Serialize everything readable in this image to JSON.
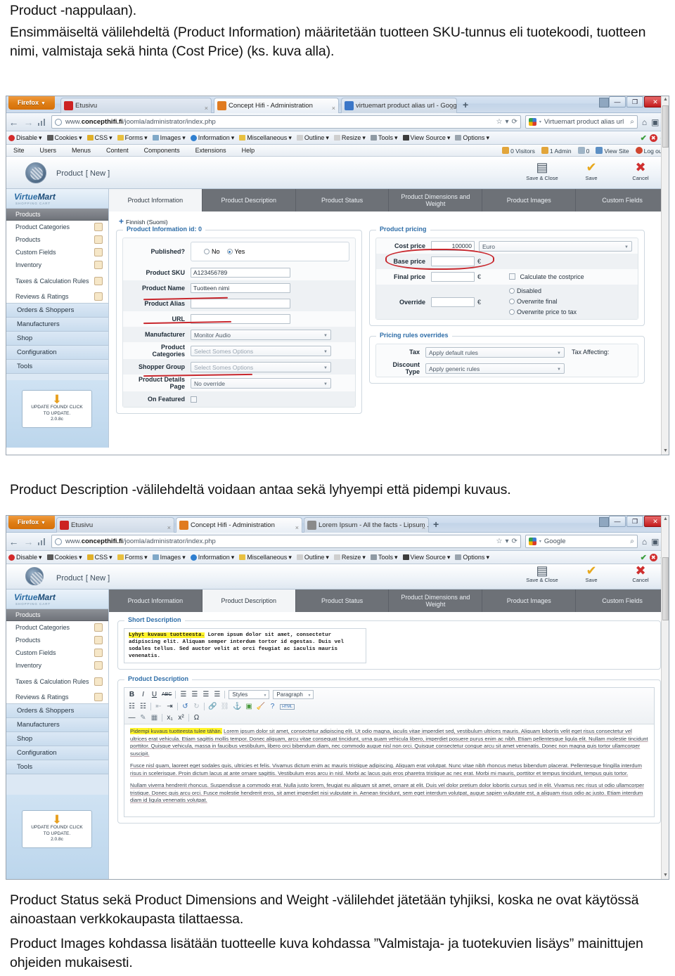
{
  "document": {
    "p_top_1": "Product -nappulaan).",
    "p_top_2": "Ensimmäiseltä välilehdeltä (Product Information) määritetään tuotteen SKU-tunnus eli tuotekoodi, tuotteen nimi, valmistaja sekä hinta (Cost Price) (ks. kuva alla).",
    "p_mid": "Product Description -välilehdeltä voidaan antaa sekä lyhyempi että pidempi kuvaus.",
    "p_bottom_1": "Product Status sekä Product Dimensions and Weight -välilehdet jätetään tyhjiksi, koska ne ovat käytössä ainoastaan verkkokaupasta tilattaessa.",
    "p_bottom_2": "Product Images kohdassa lisätään tuotteelle kuva kohdassa ”Valmistaja- ja tuotekuvien lisäys” mainittujen ohjeiden mukaisesti."
  },
  "browser": {
    "firefox_button": "Firefox",
    "caret": "▼",
    "window_controls": {
      "minimize": "—",
      "maximize": "❐",
      "close": "✕"
    },
    "new_tab": "+",
    "url": {
      "prefix": "www.",
      "bold": "concepthifi.fi",
      "suffix": "/joomla/administrator/index.php"
    },
    "url_controls": {
      "star": "☆",
      "star_caret": "▾",
      "reload": "⟳"
    },
    "nav": {
      "back": "←",
      "forward": "→",
      "signal": "signal-icon"
    },
    "home_icon": "⌂",
    "bookmarks_icon": "▣",
    "pin_icon": "▤",
    "devbar": [
      "Disable",
      "Cookies",
      "CSS",
      "Forms",
      "Images",
      "Information",
      "Miscellaneous",
      "Outline",
      "Resize",
      "Tools",
      "View Source",
      "Options"
    ],
    "devbar_caret": "▾",
    "devbar_right": {
      "check1": "✔",
      "cross": "✖",
      "check2": "✔"
    }
  },
  "shot1": {
    "tabs": [
      {
        "title": "Etusivu",
        "favicon_color": "#cc2222",
        "active": false,
        "close": "×"
      },
      {
        "title": "Concept Hifi - Administration",
        "favicon_color": "#e07b20",
        "active": true,
        "close": "×"
      },
      {
        "title": "virtuemart product alias url - Google-...",
        "favicon_color": "#3a76c8",
        "active": false,
        "close": "×"
      }
    ],
    "search": {
      "engine": "google-icon",
      "caret": "▾",
      "value": "Virtuemart product alias url",
      "magnifier": "⌕"
    }
  },
  "shot2": {
    "tabs": [
      {
        "title": "Etusivu",
        "favicon_color": "#cc2222",
        "active": false,
        "close": "×"
      },
      {
        "title": "Concept Hifi - Administration",
        "favicon_color": "#e07b20",
        "active": true,
        "close": "×"
      },
      {
        "title": "Lorem Ipsum - All the facts - Lipsum ...",
        "favicon_color": "#8a8a8a",
        "active": false,
        "close": "×"
      }
    ],
    "search": {
      "engine": "google-icon",
      "caret": "▾",
      "value": "Google",
      "magnifier": "⌕"
    }
  },
  "joomla": {
    "menu": [
      "Site",
      "Users",
      "Menus",
      "Content",
      "Components",
      "Extensions",
      "Help"
    ],
    "status": {
      "visitors": "0 Visitors",
      "admins": "1 Admin",
      "messages": "0",
      "view_site": "View Site",
      "logout": "Log out"
    },
    "header": {
      "title": "Product",
      "state": "[ New ]",
      "toolbar": [
        {
          "label": "Save & Close",
          "glyph": "▤"
        },
        {
          "label": "Save",
          "glyph": "✔"
        },
        {
          "label": "Cancel",
          "glyph": "✖"
        }
      ]
    },
    "sidebar": {
      "brand_virtue": "Virtue",
      "brand_mart": "Mart",
      "brand_tagline": "SHOPPING CART",
      "section": "Products",
      "sub_items": [
        {
          "label": "Product Categories",
          "icon": "categories-icon"
        },
        {
          "label": "Products",
          "icon": "products-icon"
        },
        {
          "label": "Custom Fields",
          "icon": "custom-fields-icon"
        },
        {
          "label": "Inventory",
          "icon": "inventory-icon"
        },
        {
          "label": "Taxes & Calculation Rules",
          "icon": "taxes-icon"
        },
        {
          "label": "Reviews & Ratings",
          "icon": "reviews-icon"
        }
      ],
      "nav_items": [
        "Orders & Shoppers",
        "Manufacturers",
        "Shop",
        "Configuration",
        "Tools"
      ],
      "update_box": {
        "arrow": "⬇",
        "line1": "UPDATE FOUND! CLICK",
        "line2": "TO UPDATE.",
        "version": "2.0.8c"
      }
    },
    "tabs": [
      "Product Information",
      "Product Description",
      "Product Status",
      "Product Dimensions and Weight",
      "Product Images",
      "Custom Fields"
    ],
    "language_row": "Finnish (Suomi)"
  },
  "product_information": {
    "legend": "Product Information id: 0",
    "fields": {
      "published_label": "Published?",
      "published_no": "No",
      "published_yes": "Yes",
      "published_value": "Yes",
      "sku_label": "Product SKU",
      "sku_value": "A123456789",
      "name_label": "Product Name",
      "name_value": "Tuotteen nimi",
      "alias_label": "Product Alias",
      "alias_value": "",
      "url_label": "URL",
      "url_value": "",
      "manufacturer_label": "Manufacturer",
      "manufacturer_value": "Monitor Audio",
      "categories_label": "Product Categories",
      "categories_placeholder": "Select Somes Options",
      "shopper_group_label": "Shopper Group",
      "shopper_group_placeholder": "Select Somes Options",
      "details_page_label": "Product Details Page",
      "details_page_value": "No override",
      "on_featured_label": "On Featured"
    }
  },
  "product_pricing": {
    "legend": "Product pricing",
    "cost_price_label": "Cost price",
    "cost_price_value": "100000",
    "currency_value": "Euro",
    "base_price_label": "Base price",
    "base_price_value": "",
    "final_price_label": "Final price",
    "final_price_value": "",
    "override_label": "Override",
    "override_value": "",
    "euro_symbol": "€",
    "calculate_costprice": "Calculate the costprice",
    "radios": [
      "Disabled",
      "Overwrite final",
      "Overwrite price to tax"
    ]
  },
  "pricing_rules": {
    "legend": "Pricing rules overrides",
    "tax_label": "Tax",
    "tax_value": "Apply default rules",
    "tax_affecting_label": "Tax Affecting:",
    "discount_label": "Discount Type",
    "discount_value": "Apply generic rules"
  },
  "product_description": {
    "short_legend": "Short Description",
    "short_highlight": "Lyhyt kuvaus tuotteesta.",
    "short_body": "Lorem ipsum dolor sit amet, consectetur adipiscing elit. Aliquam semper interdum tortor id egestas. Duis vel sodales tellus. Sed auctor velit at orci feugiat ac iaculis mauris venenatis.",
    "long_legend": "Product Description",
    "toolbar_row1": [
      "B",
      "I",
      "U",
      "ABC",
      "align-left",
      "align-center",
      "align-right",
      "align-justify"
    ],
    "toolbar_styles": "Styles",
    "toolbar_format": "Paragraph",
    "toolbar_row2": [
      "ul",
      "ol",
      "outdent",
      "indent",
      "undo",
      "redo",
      "link",
      "unlink",
      "anchor",
      "image",
      "cleanup",
      "help",
      "HTML"
    ],
    "toolbar_row3": [
      "hr",
      "eraser",
      "table",
      "subscript",
      "superscript",
      "Ω"
    ],
    "long_highlight": "Pidempi kuvaus tuotteesta tulee tähän.",
    "long_paragraphs": [
      "Lorem ipsum dolor sit amet, consectetur adipiscing elit. Ut odio magna, iaculis vitae imperdiet sed, vestibulum ultrices mauris. Aliquam lobortis velit eget risus consectetur vel ultrices erat vehicula. Etiam sagittis mollis tempor. Donec aliquam, arcu vitae consequat tincidunt, urna quam vehicula libero, imperdiet posuere purus enim ac nibh. Etiam pellentesque ligula elit. Nullam molestie tincidunt porttitor. Quisque vehicula, massa in faucibus vestibulum, libero orci bibendum diam, nec commodo augue nisl non orci. Quisque consectetur congue arcu sit amet venenatis. Donec non magna quis tortor ullamcorper suscipit.",
      "Fusce nisl quam, laoreet eget sodales quis, ultricies et felis. Vivamus dictum enim ac mauris tristique adipiscing. Aliquam erat volutpat. Nunc vitae nibh rhoncus metus bibendum placerat. Pellentesque fringilla interdum risus in scelerisque. Proin dictum lacus at ante ornare sagittis. Vestibulum eros arcu in nisl. Morbi ac lacus quis eros pharetra tristique ac nec erat. Morbi mi mauris, porttitor et tempus tincidunt, tempus quis tortor.",
      "Nullam viverra hendrerit rhoncus. Suspendisse a commodo erat. Nulla justo lorem, feugiat eu aliquam sit amet, ornare at elit. Duis vel dolor pretium dolor lobortis cursus sed in elit. Vivamus nec risus ut odio ullamcorper tristique. Donec quis arcu orci. Fusce molestie hendrerit eros, sit amet imperdiet nisi vulputate in. Aenean tincidunt, sem eget interdum volutpat, augue sapien vulputate est, a aliquam risus odio ac justo. Etiam interdum diam id ligula venenatis volutpat."
    ]
  },
  "colors": {
    "annotation_red": "#c8272d",
    "highlight_yellow": "#fff42b",
    "legend_blue": "#2f6ea8",
    "tab_gray": "#6d7177",
    "sidebar_blue": "#dce8f4"
  }
}
